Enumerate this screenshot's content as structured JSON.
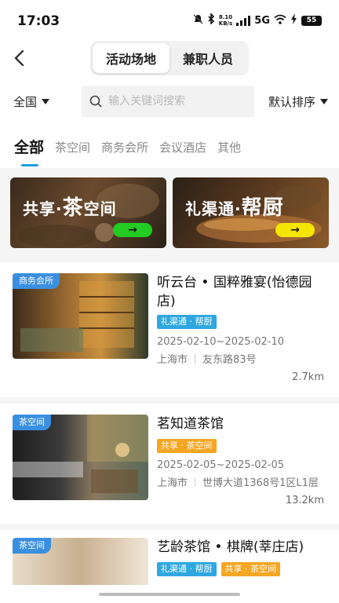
{
  "status_bar": {
    "time": "17:03",
    "net_speed_value": "8.10",
    "net_speed_unit": "KB/s",
    "network": "5G",
    "battery": "55"
  },
  "header": {
    "segments": [
      {
        "label": "活动场地",
        "active": true
      },
      {
        "label": "兼职人员",
        "active": false
      }
    ]
  },
  "filters": {
    "region": "全国",
    "search_placeholder": "输入关键词搜索",
    "sort": "默认排序"
  },
  "tabs": [
    {
      "label": "全部",
      "active": true
    },
    {
      "label": "茶空间",
      "active": false
    },
    {
      "label": "商务会所",
      "active": false
    },
    {
      "label": "会议酒店",
      "active": false
    },
    {
      "label": "其他",
      "active": false
    }
  ],
  "banners": [
    {
      "prefix": "共享·",
      "big": "茶",
      "suffix": "空间",
      "arrow": "→",
      "button_color": "#22cc22"
    },
    {
      "prefix": "礼渠通·",
      "big": "帮厨",
      "suffix": "",
      "arrow": "→",
      "button_color": "#f5e600"
    }
  ],
  "venues": [
    {
      "badge": "商务会所",
      "name": "听云台 • 国粹雅宴(怡德园店)",
      "tags": [
        {
          "label": "礼渠通 · 帮厨",
          "color": "blue"
        }
      ],
      "date": "2025-02-10~2025-02-10",
      "city": "上海市",
      "address": "友东路83号",
      "distance": "2.7km"
    },
    {
      "badge": "茶空间",
      "name": "茗知道茶馆",
      "tags": [
        {
          "label": "共享 · 茶空间",
          "color": "orange"
        }
      ],
      "date": "2025-02-05~2025-02-05",
      "city": "上海市",
      "address": "世博大道1368号1区L1层",
      "distance": "13.2km"
    },
    {
      "badge": "茶空间",
      "name": "艺龄茶馆 • 棋牌(莘庄店)",
      "tags": [
        {
          "label": "礼渠通 · 帮厨",
          "color": "blue"
        },
        {
          "label": "共享 · 茶空间",
          "color": "orange"
        }
      ]
    }
  ],
  "colors": {
    "accent": "#1aa0e0",
    "badge": "#3b8fe0",
    "tag_blue": "#2ea7e0",
    "tag_orange": "#f5a623"
  }
}
